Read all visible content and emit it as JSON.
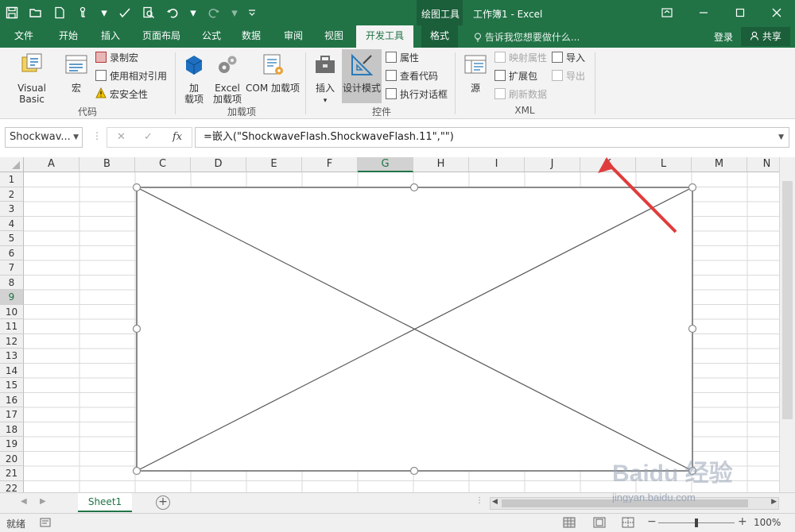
{
  "window": {
    "title": "工作簿1 - Excel",
    "context_tab": "绘图工具",
    "accent": "#217346"
  },
  "qat": {
    "icons": [
      "save-icon",
      "open-icon",
      "new-icon",
      "touch-icon",
      "spellcheck-icon",
      "print-preview-icon",
      "undo-icon",
      "redo-icon",
      "customize-qat-icon"
    ]
  },
  "tabs": [
    {
      "label": "文件"
    },
    {
      "label": "开始"
    },
    {
      "label": "插入"
    },
    {
      "label": "页面布局"
    },
    {
      "label": "公式"
    },
    {
      "label": "数据"
    },
    {
      "label": "审阅"
    },
    {
      "label": "视图"
    },
    {
      "label": "开发工具",
      "active": true
    },
    {
      "label": "格式"
    }
  ],
  "tell_me": "告诉我您想要做什么...",
  "login": "登录",
  "share": "共享",
  "ribbon": {
    "code": {
      "label": "代码",
      "visual_basic": "Visual Basic",
      "macros": "宏",
      "record_macro": "录制宏",
      "relative_ref": "使用相对引用",
      "macro_security": "宏安全性"
    },
    "addins": {
      "label": "加载项",
      "addins_line1": "加",
      "addins_line2": "载项",
      "excel_addins_line1": "Excel",
      "excel_addins_line2": "加载项",
      "com_addins": "COM 加载项"
    },
    "controls": {
      "label": "控件",
      "insert": "插入",
      "design_mode": "设计模式",
      "properties": "属性",
      "view_code": "查看代码",
      "run_dialog": "执行对话框"
    },
    "xml": {
      "label": "XML",
      "source": "源",
      "map_properties": "映射属性",
      "expansion_packs": "扩展包",
      "refresh_data": "刷新数据",
      "import": "导入",
      "export": "导出"
    }
  },
  "formula_bar": {
    "name_box": "Shockwav...",
    "cancel": "✕",
    "enter": "✓",
    "fx": "fx",
    "formula": "=嵌入(\"ShockwaveFlash.ShockwaveFlash.11\",\"\")"
  },
  "grid": {
    "columns": [
      "A",
      "B",
      "C",
      "D",
      "E",
      "F",
      "G",
      "H",
      "I",
      "J",
      "K",
      "L",
      "M",
      "N"
    ],
    "rows": [
      "1",
      "2",
      "3",
      "4",
      "5",
      "6",
      "7",
      "8",
      "9",
      "10",
      "11",
      "12",
      "13",
      "14",
      "15",
      "16",
      "17",
      "18",
      "19",
      "20",
      "21",
      "22"
    ],
    "selected_column": "G",
    "selected_row": "9"
  },
  "sheets": [
    {
      "label": "Sheet1",
      "active": true
    }
  ],
  "status": {
    "ready": "就绪",
    "zoom": "100%",
    "zoom_level": 1.0
  },
  "watermark": {
    "text": "Baidu 经验",
    "url": "jingyan.baidu.com"
  }
}
